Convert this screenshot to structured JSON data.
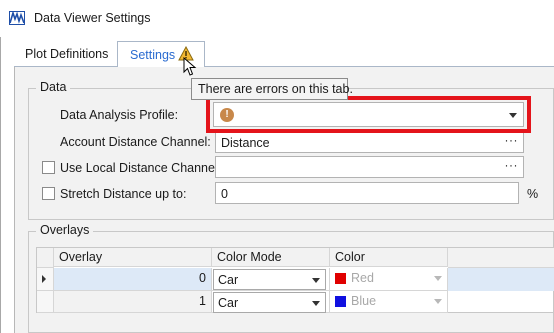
{
  "window": {
    "title": "Data Viewer Settings"
  },
  "tabs": [
    {
      "label": "Plot Definitions",
      "active": false
    },
    {
      "label": "Settings",
      "active": true,
      "icon": "warning-icon"
    }
  ],
  "tooltip": {
    "text": "There are errors on this tab."
  },
  "data_group": {
    "title": "Data",
    "profile_label": "Data Analysis Profile:",
    "profile_value": "",
    "profile_status_icon": "error-icon",
    "account_label": "Account Distance Channel:",
    "account_value": "Distance",
    "local_label": "Use Local Distance Channel:",
    "local_checked": false,
    "local_value": "",
    "stretch_label": "Stretch Distance up to:",
    "stretch_checked": false,
    "stretch_value": "0",
    "stretch_unit": "%",
    "ellipsis": "···"
  },
  "overlays_group": {
    "title": "Overlays",
    "columns": [
      "Overlay",
      "Color Mode",
      "Color"
    ],
    "rows": [
      {
        "overlay": "0",
        "color_mode": "Car",
        "color_name": "Red",
        "color": "#e00000",
        "selected": true
      },
      {
        "overlay": "1",
        "color_mode": "Car",
        "color_name": "Blue",
        "color": "#1010e0",
        "selected": false
      }
    ]
  },
  "colors": {
    "accent": "#2a6bd0",
    "error_outline": "#e4141b",
    "warning": "#e0a020"
  }
}
